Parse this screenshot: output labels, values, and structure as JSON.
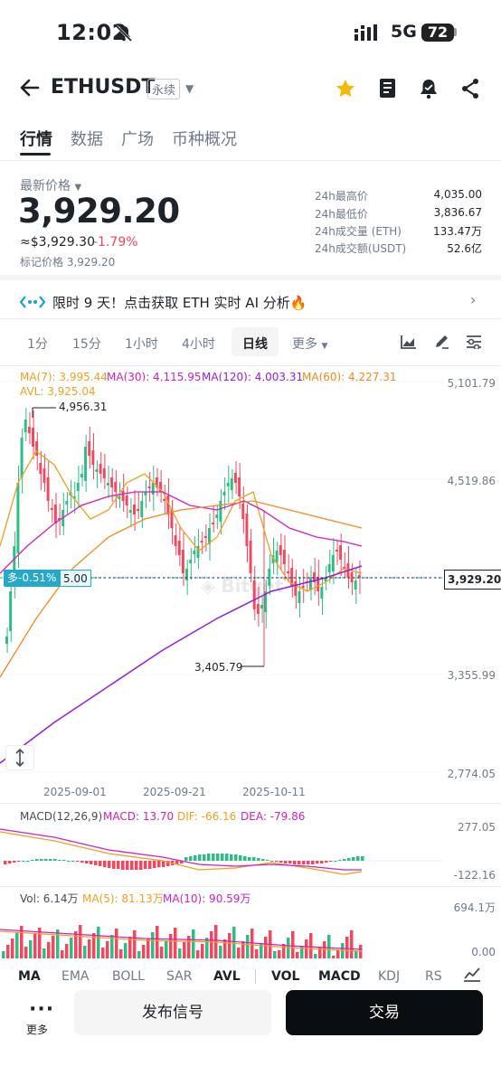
{
  "status_bar": {
    "time": "12:02",
    "network": "5G",
    "battery": "72"
  },
  "header": {
    "symbol": "ETHUSDT",
    "contract_type": "永续"
  },
  "tabs": [
    {
      "label": "行情",
      "active": true
    },
    {
      "label": "数据",
      "active": false
    },
    {
      "label": "广场",
      "active": false
    },
    {
      "label": "币种概况",
      "active": false
    }
  ],
  "price": {
    "label": "最新价格",
    "last": "3,929.20",
    "usd": "≈$3,929.30",
    "change": "-1.79%",
    "mark": "标记价格 3,929.20"
  },
  "stats": [
    {
      "label": "24h最高价",
      "value": "4,035.00"
    },
    {
      "label": "24h最低价",
      "value": "3,836.67"
    },
    {
      "label": "24h成交量 (ETH)",
      "value": "133.47万"
    },
    {
      "label": "24h成交额(USDT)",
      "value": "52.6亿"
    }
  ],
  "promo": {
    "text": "限时 9 天！点击获取 ETH 实时 AI 分析🔥"
  },
  "intervals": [
    {
      "label": "1分",
      "active": false
    },
    {
      "label": "15分",
      "active": false
    },
    {
      "label": "1小时",
      "active": false
    },
    {
      "label": "4小时",
      "active": false
    },
    {
      "label": "日线",
      "active": true
    },
    {
      "label": "更多",
      "active": false
    }
  ],
  "main_chart": {
    "legend": {
      "ma7": "MA(7): 3,995.44",
      "ma30": "MA(30): 4,115.95",
      "ma120": "MA(120): 4,003.31",
      "ma60": "MA(60): 4,227.31",
      "avl": "AVL: 3,925.04"
    },
    "y_ticks": [
      "5,101.79",
      "4,519.86",
      "3,355.99",
      "2,774.05"
    ],
    "x_ticks": [
      "2025-09-01",
      "2025-09-21",
      "2025-10-11"
    ],
    "high_annotation": "4,956.31",
    "low_annotation": "3,405.79",
    "position_tag": "多-0.51%",
    "position_value": "5.00",
    "current_price": "3,929.20",
    "colors": {
      "up": "#2ebd85",
      "down": "#f6465d",
      "ma7": "#f0a020",
      "ma30": "#d020c0",
      "ma60": "#f08a20",
      "ma120": "#9020e0"
    }
  },
  "macd": {
    "legend_title": "MACD(12,26,9)",
    "macd": "MACD: 13.70",
    "dif": "DIF: -66.16",
    "dea": "DEA: -79.86",
    "y_ticks": [
      "277.05",
      "-122.16"
    ]
  },
  "volume": {
    "vol": "Vol: 6.14万",
    "ma5": "MA(5): 81.13万",
    "ma10": "MA(10): 90.59万",
    "y_ticks": [
      "694.1万",
      "0.00"
    ]
  },
  "indicators": [
    {
      "label": "MA",
      "on": true
    },
    {
      "label": "EMA",
      "on": false
    },
    {
      "label": "BOLL",
      "on": false
    },
    {
      "label": "SAR",
      "on": false
    },
    {
      "label": "AVL",
      "on": true
    },
    {
      "label": "VOL",
      "on": true
    },
    {
      "label": "MACD",
      "on": true
    },
    {
      "label": "KDJ",
      "on": false
    },
    {
      "label": "RS",
      "on": false
    }
  ],
  "footer": {
    "more_label": "更多",
    "signal_button": "发布信号",
    "trade_button": "交易"
  }
}
